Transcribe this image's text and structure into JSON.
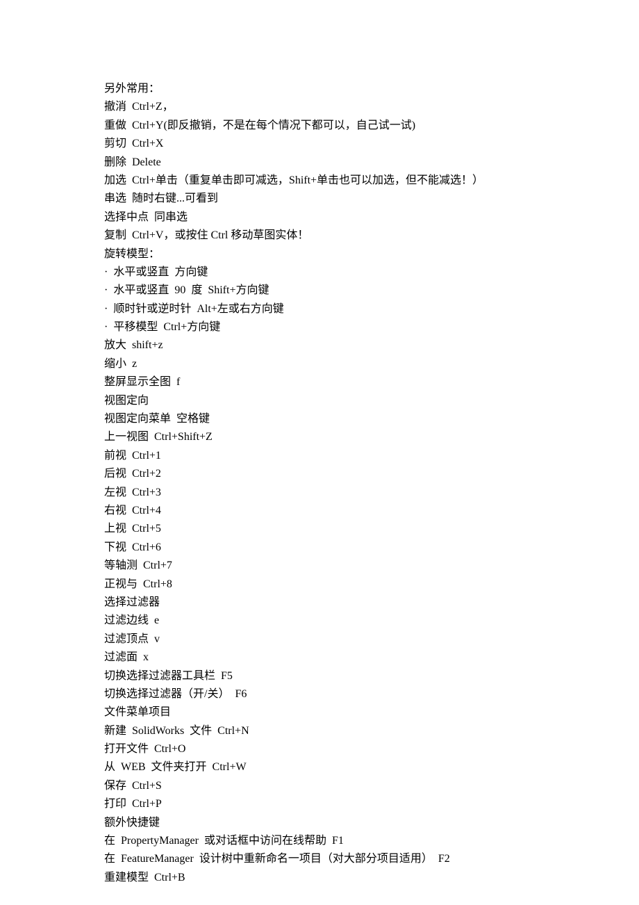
{
  "lines": [
    "另外常用：",
    "撤消  Ctrl+Z，",
    "重做  Ctrl+Y(即反撤销，不是在每个情况下都可以，自己试一试)",
    "剪切  Ctrl+X",
    "删除  Delete",
    "加选  Ctrl+单击（重复单击即可减选，Shift+单击也可以加选，但不能减选！）",
    "串选  随时右键...可看到",
    "选择中点  同串选",
    "复制  Ctrl+V，或按住 Ctrl 移动草图实体！",
    "旋转模型：",
    "·  水平或竖直  方向键",
    "·  水平或竖直  90  度  Shift+方向键",
    "·  顺时针或逆时针  Alt+左或右方向键",
    "·  平移模型  Ctrl+方向键",
    "放大  shift+z",
    "缩小  z",
    "整屏显示全图  f",
    "视图定向",
    "视图定向菜单  空格键",
    "上一视图  Ctrl+Shift+Z",
    "前视  Ctrl+1",
    "后视  Ctrl+2",
    "左视  Ctrl+3",
    "右视  Ctrl+4",
    "上视  Ctrl+5",
    "下视  Ctrl+6",
    "等轴测  Ctrl+7",
    "正视与  Ctrl+8",
    "选择过滤器",
    "过滤边线  e",
    "过滤顶点  v",
    "过滤面  x",
    "切换选择过滤器工具栏  F5",
    "切换选择过滤器（开/关）  F6",
    "文件菜单项目",
    "新建  SolidWorks  文件  Ctrl+N",
    "打开文件  Ctrl+O",
    "从  WEB  文件夹打开  Ctrl+W",
    "保存  Ctrl+S",
    "打印  Ctrl+P",
    "额外快捷键",
    "在  PropertyManager  或对话框中访问在线帮助  F1",
    "在  FeatureManager  设计树中重新命名一项目（对大部分项目适用）  F2",
    "重建模型  Ctrl+B"
  ]
}
